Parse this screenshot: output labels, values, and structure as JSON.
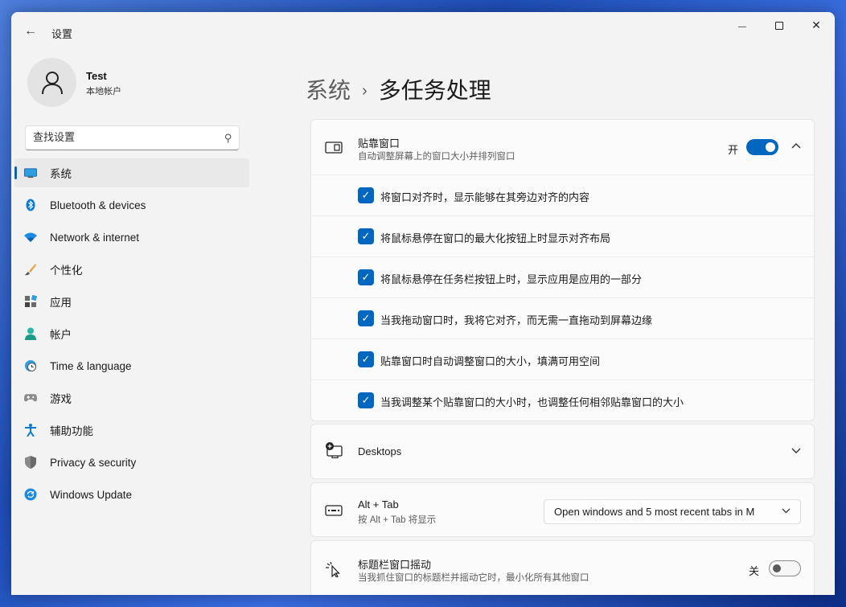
{
  "window": {
    "app_title": "设置",
    "back_glyph": "←",
    "minimize_glyph": "—",
    "close_glyph": "✕"
  },
  "profile": {
    "name": "Test",
    "account_type": "本地帐户"
  },
  "search": {
    "placeholder": "查找设置"
  },
  "sidebar": {
    "items": [
      {
        "label": "系统",
        "icon": "monitor-icon",
        "active": true
      },
      {
        "label": "Bluetooth & devices",
        "icon": "bluetooth-icon"
      },
      {
        "label": "Network & internet",
        "icon": "wifi-icon"
      },
      {
        "label": "个性化",
        "icon": "brush-icon"
      },
      {
        "label": "应用",
        "icon": "apps-icon"
      },
      {
        "label": "帐户",
        "icon": "person-icon"
      },
      {
        "label": "Time & language",
        "icon": "globe-clock-icon"
      },
      {
        "label": "游戏",
        "icon": "gamepad-icon"
      },
      {
        "label": "辅助功能",
        "icon": "accessibility-icon"
      },
      {
        "label": "Privacy & security",
        "icon": "shield-icon"
      },
      {
        "label": "Windows Update",
        "icon": "update-icon"
      }
    ]
  },
  "breadcrumb": {
    "parent": "系统",
    "separator": "›",
    "current": "多任务处理"
  },
  "snap": {
    "title": "贴靠窗口",
    "description": "自动调整屏幕上的窗口大小并排列窗口",
    "toggle_label": "开",
    "toggle_on": true,
    "expanded": true,
    "options": [
      {
        "label": "将窗口对齐时，显示能够在其旁边对齐的内容",
        "checked": true
      },
      {
        "label": "将鼠标悬停在窗口的最大化按钮上时显示对齐布局",
        "checked": true
      },
      {
        "label": "将鼠标悬停在任务栏按钮上时，显示应用是应用的一部分",
        "checked": true
      },
      {
        "label": "当我拖动窗口时，我将它对齐，而无需一直拖动到屏幕边缘",
        "checked": true
      },
      {
        "label": "贴靠窗口时自动调整窗口的大小，填满可用空间",
        "checked": true
      },
      {
        "label": "当我调整某个贴靠窗口的大小时，也调整任何相邻贴靠窗口的大小",
        "checked": true
      }
    ]
  },
  "desktops": {
    "title": "Desktops"
  },
  "alttab": {
    "title": "Alt + Tab",
    "description": "按 Alt + Tab 将显示",
    "selected_option": "Open windows and 5 most recent tabs in M"
  },
  "shake": {
    "title": "标题栏窗口摇动",
    "description": "当我抓住窗口的标题栏并摇动它时，最小化所有其他窗口",
    "toggle_label": "关",
    "toggle_on": false
  },
  "colors": {
    "accent": "#0067c0",
    "window_bg": "#f3f3f3",
    "card_bg": "#fbfbfb"
  }
}
